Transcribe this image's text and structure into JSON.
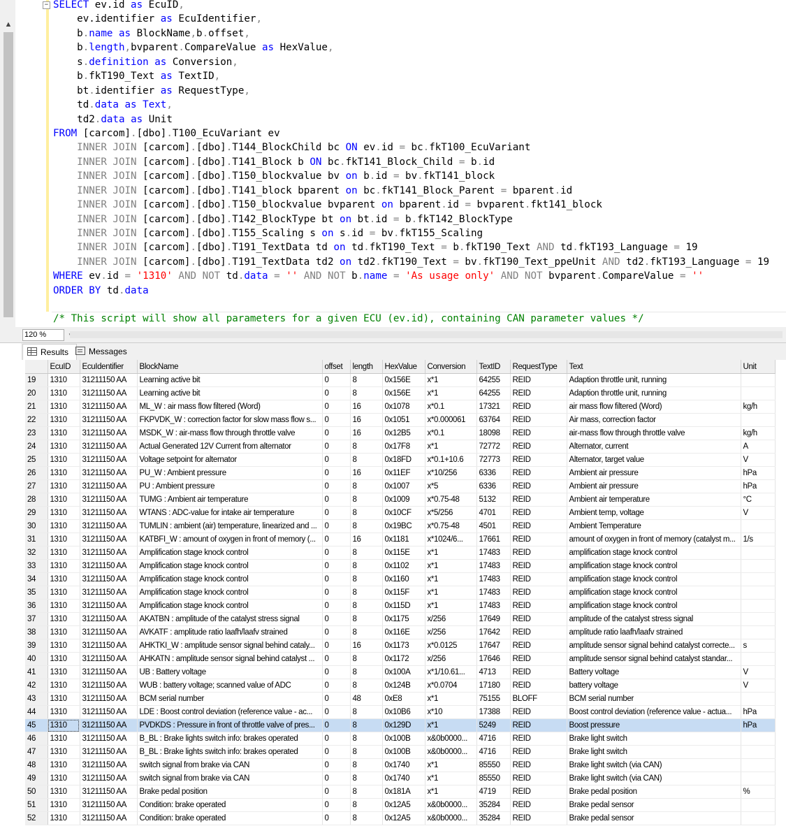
{
  "editor": {
    "collapse_glyph": "−",
    "comment": "/* This script will show all parameters for a given ECU (ev.id), containing CAN parameter values */"
  },
  "zoom": {
    "value": "120 %"
  },
  "tabs": {
    "results": "Results",
    "messages": "Messages"
  },
  "grid": {
    "columns": [
      "EcuID",
      "EcuIdentifier",
      "BlockName",
      "offset",
      "length",
      "HexValue",
      "Conversion",
      "TextID",
      "RequestType",
      "Text",
      "Unit"
    ],
    "selected_row": "45",
    "rows": [
      [
        "19",
        "1310",
        "31211150 AA",
        "Learning active bit",
        "0",
        "8",
        "0x156E",
        "x*1",
        "64255",
        "REID",
        "Adaption throttle unit, running",
        ""
      ],
      [
        "20",
        "1310",
        "31211150 AA",
        "Learning active bit",
        "0",
        "8",
        "0x156E",
        "x*1",
        "64255",
        "REID",
        "Adaption throttle unit, running",
        ""
      ],
      [
        "21",
        "1310",
        "31211150 AA",
        "ML_W : air mass flow filtered (Word)",
        "0",
        "16",
        "0x1078",
        "x*0.1",
        "17321",
        "REID",
        "air mass flow filtered (Word)",
        "kg/h"
      ],
      [
        "22",
        "1310",
        "31211150 AA",
        "FKPVDK_W : correction factor for slow mass flow s...",
        "0",
        "16",
        "0x1051",
        "x*0.000061",
        "63764",
        "REID",
        "Air mass, correction factor",
        ""
      ],
      [
        "23",
        "1310",
        "31211150 AA",
        "MSDK_W : air-mass flow through throttle valve",
        "0",
        "16",
        "0x12B5",
        "x*0.1",
        "18098",
        "REID",
        "air-mass flow through throttle valve",
        "kg/h"
      ],
      [
        "24",
        "1310",
        "31211150 AA",
        "Actual Generated 12V Current from alternator",
        "0",
        "8",
        "0x17F8",
        "x*1",
        "72772",
        "REID",
        "Alternator, current",
        "A"
      ],
      [
        "25",
        "1310",
        "31211150 AA",
        "Voltage setpoint for alternator",
        "0",
        "8",
        "0x18FD",
        "x*0.1+10.6",
        "72773",
        "REID",
        "Alternator, target value",
        "V"
      ],
      [
        "26",
        "1310",
        "31211150 AA",
        "PU_W : Ambient pressure",
        "0",
        "16",
        "0x11EF",
        "x*10/256",
        "6336",
        "REID",
        "Ambient air pressure",
        "hPa"
      ],
      [
        "27",
        "1310",
        "31211150 AA",
        "PU : Ambient pressure",
        "0",
        "8",
        "0x1007",
        "x*5",
        "6336",
        "REID",
        "Ambient air pressure",
        "hPa"
      ],
      [
        "28",
        "1310",
        "31211150 AA",
        "TUMG : Ambient air temperature",
        "0",
        "8",
        "0x1009",
        "x*0.75-48",
        "5132",
        "REID",
        "Ambient air temperature",
        "°C"
      ],
      [
        "29",
        "1310",
        "31211150 AA",
        "WTANS : ADC-value for intake air temperature",
        "0",
        "8",
        "0x10CF",
        "x*5/256",
        "4701",
        "REID",
        "Ambient temp, voltage",
        "V"
      ],
      [
        "30",
        "1310",
        "31211150 AA",
        "TUMLIN : ambient (air) temperature, linearized and ...",
        "0",
        "8",
        "0x19BC",
        "x*0.75-48",
        "4501",
        "REID",
        "Ambient Temperature",
        ""
      ],
      [
        "31",
        "1310",
        "31211150 AA",
        "KATBFI_W : amount of oxygen in front of memory (...",
        "0",
        "16",
        "0x1181",
        "x*1024/6...",
        "17661",
        "REID",
        "amount of oxygen in front of memory (catalyst m...",
        "1/s"
      ],
      [
        "32",
        "1310",
        "31211150 AA",
        "Amplification stage knock control",
        "0",
        "8",
        "0x115E",
        "x*1",
        "17483",
        "REID",
        "amplification stage knock control",
        ""
      ],
      [
        "33",
        "1310",
        "31211150 AA",
        "Amplification stage knock control",
        "0",
        "8",
        "0x1102",
        "x*1",
        "17483",
        "REID",
        "amplification stage knock control",
        ""
      ],
      [
        "34",
        "1310",
        "31211150 AA",
        "Amplification stage knock control",
        "0",
        "8",
        "0x1160",
        "x*1",
        "17483",
        "REID",
        "amplification stage knock control",
        ""
      ],
      [
        "35",
        "1310",
        "31211150 AA",
        "Amplification stage knock control",
        "0",
        "8",
        "0x115F",
        "x*1",
        "17483",
        "REID",
        "amplification stage knock control",
        ""
      ],
      [
        "36",
        "1310",
        "31211150 AA",
        "Amplification stage knock control",
        "0",
        "8",
        "0x115D",
        "x*1",
        "17483",
        "REID",
        "amplification stage knock control",
        ""
      ],
      [
        "37",
        "1310",
        "31211150 AA",
        "AKATBN : amplitude of the catalyst stress signal",
        "0",
        "8",
        "0x1175",
        "x/256",
        "17649",
        "REID",
        "amplitude of the catalyst stress signal",
        ""
      ],
      [
        "38",
        "1310",
        "31211150 AA",
        "AVKATF : amplitude ratio laafh/laafv strained",
        "0",
        "8",
        "0x116E",
        "x/256",
        "17642",
        "REID",
        "amplitude ratio laafh/laafv strained",
        ""
      ],
      [
        "39",
        "1310",
        "31211150 AA",
        "AHKTKI_W : amplitude sensor signal behind cataly...",
        "0",
        "16",
        "0x1173",
        "x*0.0125",
        "17647",
        "REID",
        "amplitude sensor signal behind catalyst correcte...",
        "s"
      ],
      [
        "40",
        "1310",
        "31211150 AA",
        "AHKATN : amplitude sensor signal behind catalyst ...",
        "0",
        "8",
        "0x1172",
        "x/256",
        "17646",
        "REID",
        "amplitude sensor signal behind catalyst standar...",
        ""
      ],
      [
        "41",
        "1310",
        "31211150 AA",
        "UB : Battery voltage",
        "0",
        "8",
        "0x100A",
        "x*1/10.61...",
        "4713",
        "REID",
        "Battery voltage",
        "V"
      ],
      [
        "42",
        "1310",
        "31211150 AA",
        "WUB : battery voltage; scanned value of ADC",
        "0",
        "8",
        "0x124B",
        "x*0.0704",
        "17180",
        "REID",
        "battery voltage",
        "V"
      ],
      [
        "43",
        "1310",
        "31211150 AA",
        "BCM serial number",
        "0",
        "48",
        "0xE8",
        "x*1",
        "75155",
        "BLOFF",
        "BCM serial number",
        ""
      ],
      [
        "44",
        "1310",
        "31211150 AA",
        "LDE : Boost control deviation (reference value - ac...",
        "0",
        "8",
        "0x10B6",
        "x*10",
        "17388",
        "REID",
        "Boost control deviation (reference value - actua...",
        "hPa"
      ],
      [
        "45",
        "1310",
        "31211150 AA",
        "PVDKDS : Pressure in front of throttle valve of pres...",
        "0",
        "8",
        "0x129D",
        "x*1",
        "5249",
        "REID",
        "Boost pressure",
        "hPa"
      ],
      [
        "46",
        "1310",
        "31211150 AA",
        "B_BL : Brake lights switch info: brakes operated",
        "0",
        "8",
        "0x100B",
        "x&0b0000...",
        "4716",
        "REID",
        "Brake light switch",
        ""
      ],
      [
        "47",
        "1310",
        "31211150 AA",
        "B_BL : Brake lights switch info: brakes operated",
        "0",
        "8",
        "0x100B",
        "x&0b0000...",
        "4716",
        "REID",
        "Brake light switch",
        ""
      ],
      [
        "48",
        "1310",
        "31211150 AA",
        "switch signal from brake via CAN",
        "0",
        "8",
        "0x1740",
        "x*1",
        "85550",
        "REID",
        "Brake light switch (via CAN)",
        ""
      ],
      [
        "49",
        "1310",
        "31211150 AA",
        "switch signal from brake via CAN",
        "0",
        "8",
        "0x1740",
        "x*1",
        "85550",
        "REID",
        "Brake light switch (via CAN)",
        ""
      ],
      [
        "50",
        "1310",
        "31211150 AA",
        "Brake pedal position",
        "0",
        "8",
        "0x181A",
        "x*1",
        "4719",
        "REID",
        "Brake pedal position",
        "%"
      ],
      [
        "51",
        "1310",
        "31211150 AA",
        "Condition: brake operated",
        "0",
        "8",
        "0x12A5",
        "x&0b0000...",
        "35284",
        "REID",
        "Brake pedal sensor",
        ""
      ],
      [
        "52",
        "1310",
        "31211150 AA",
        "Condition: brake operated",
        "0",
        "8",
        "0x12A5",
        "x&0b0000...",
        "35284",
        "REID",
        "Brake pedal sensor",
        ""
      ]
    ]
  }
}
